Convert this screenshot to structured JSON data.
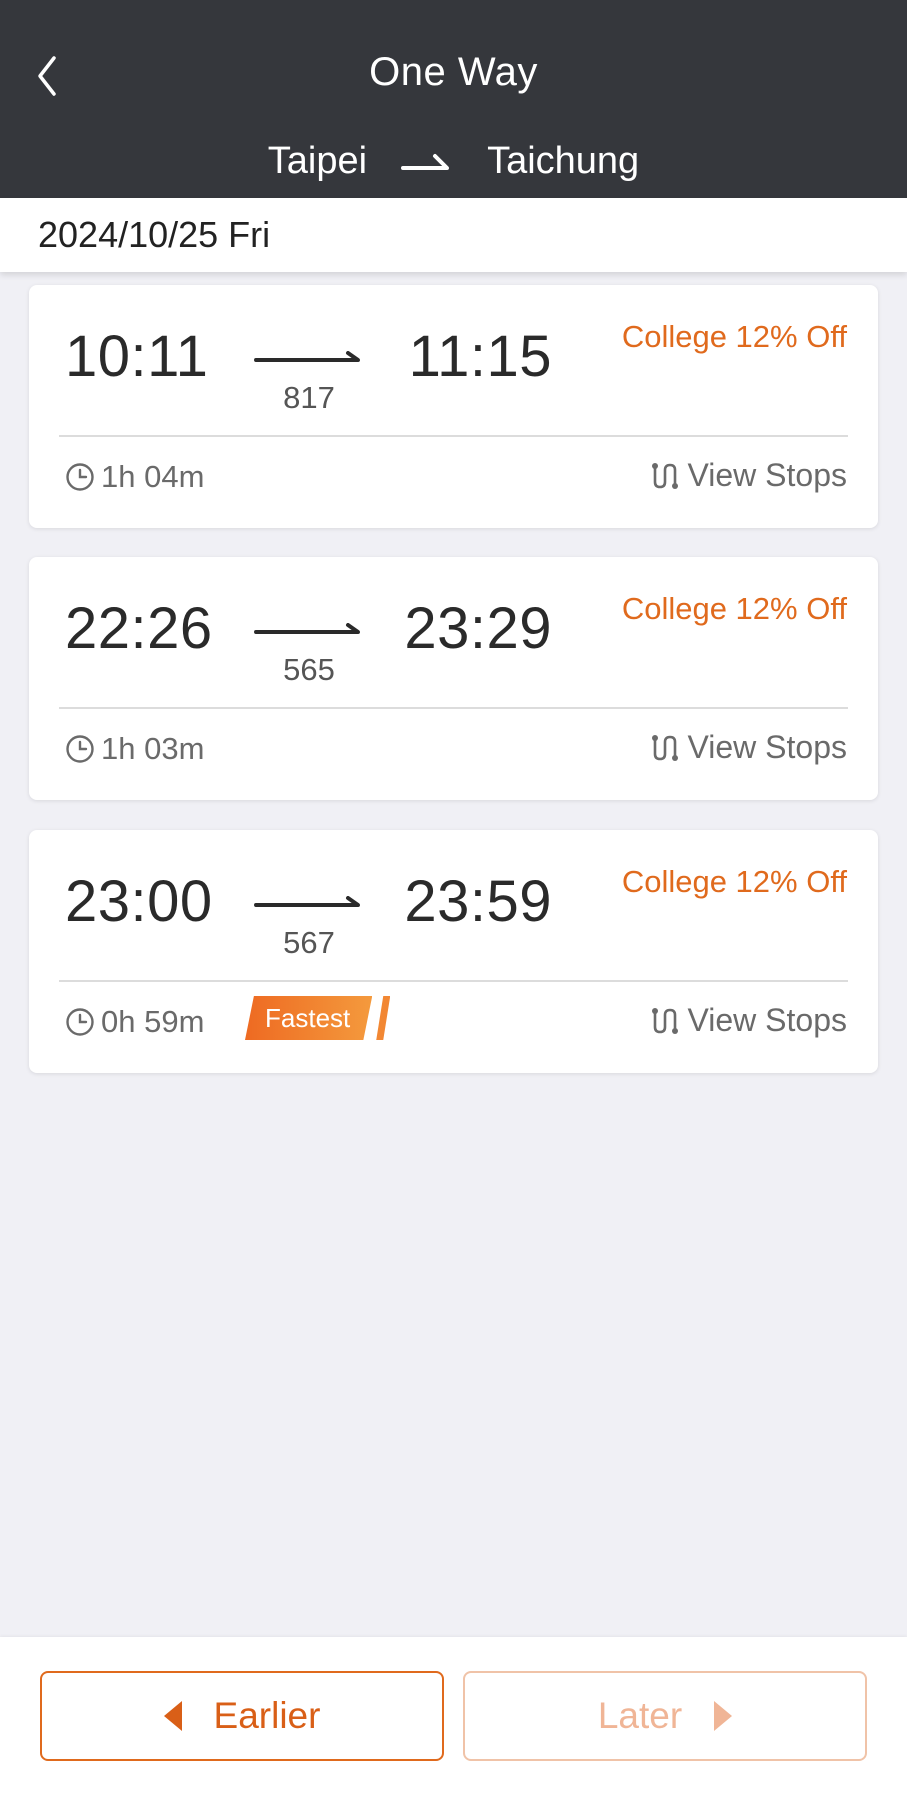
{
  "header": {
    "title": "One Way",
    "origin": "Taipei",
    "destination": "Taichung",
    "background": "#35373c",
    "back_icon": "chevron-left-icon",
    "route_icon": "route-arrow-icon"
  },
  "date": "2024/10/25 Fri",
  "accent_color": "#e06a1d",
  "trains": [
    {
      "departure": "10:11",
      "arrival": "11:15",
      "train_no": "817",
      "discount": "College 12% Off",
      "duration": "1h 04m",
      "view_stops": "View Stops"
    },
    {
      "departure": "22:26",
      "arrival": "23:29",
      "train_no": "565",
      "discount": "College 12% Off",
      "duration": "1h 03m",
      "view_stops": "View Stops"
    },
    {
      "departure": "23:00",
      "arrival": "23:59",
      "train_no": "567",
      "discount": "College 12% Off",
      "duration": "0h 59m",
      "view_stops": "View Stops",
      "badge": "Fastest"
    }
  ],
  "footer": {
    "earlier_label": "Earlier",
    "later_label": "Later"
  }
}
